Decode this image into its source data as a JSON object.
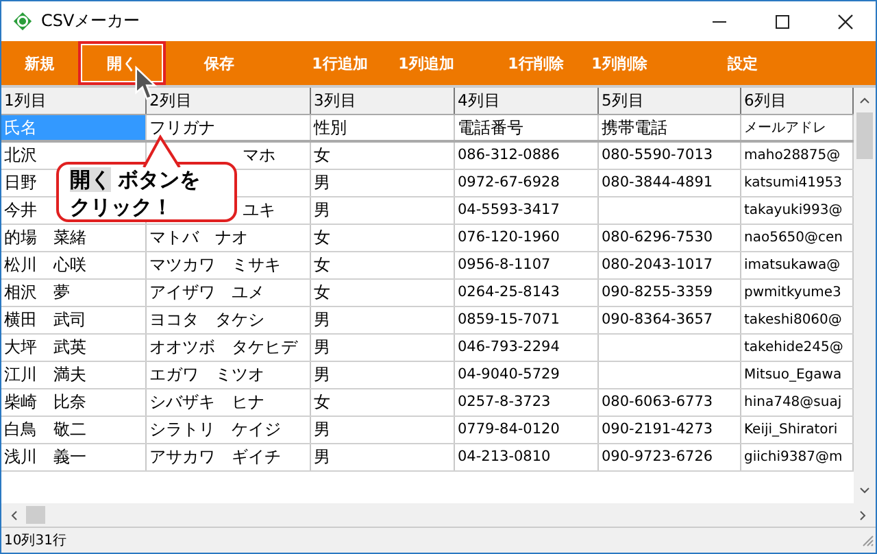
{
  "window": {
    "title": "CSVメーカー"
  },
  "toolbar": [
    {
      "label": "新規",
      "highlighted": false
    },
    {
      "label": "開く",
      "highlighted": true
    },
    {
      "label": "保存",
      "highlighted": false
    },
    {
      "label": "1行追加",
      "highlighted": false
    },
    {
      "label": "1列追加",
      "highlighted": false
    },
    {
      "label": "1行削除",
      "highlighted": false
    },
    {
      "label": "1列削除",
      "highlighted": false
    },
    {
      "label": "設定",
      "highlighted": false
    }
  ],
  "callout": {
    "highlight": "開く",
    "text": "ボタンを",
    "line2": "クリック！"
  },
  "table": {
    "columns": [
      "1列目",
      "2列目",
      "3列目",
      "4列目",
      "5列目",
      "6列目"
    ],
    "rows": [
      {
        "cells": [
          {
            "text": "氏名",
            "selected": true
          },
          {
            "text": "フリガナ",
            "selected": false
          },
          {
            "text": "性別",
            "selected": false
          },
          {
            "text": "電話番号",
            "selected": false
          },
          {
            "text": "携帯電話",
            "selected": false
          },
          {
            "text": "メールアドレ",
            "selected": false
          }
        ]
      },
      {
        "cells": [
          {
            "text": "北沢",
            "selected": false
          },
          {
            "text": "マホ",
            "selected": false
          },
          {
            "text": "女",
            "selected": false
          },
          {
            "text": "086-312-0886",
            "selected": false
          },
          {
            "text": "080-5590-7013",
            "selected": false
          },
          {
            "text": "maho28875@",
            "selected": false
          }
        ]
      },
      {
        "cells": [
          {
            "text": "日野",
            "selected": false
          },
          null,
          {
            "text": "男",
            "selected": false
          },
          {
            "text": "0972-67-6928",
            "selected": false
          },
          {
            "text": "080-3844-4891",
            "selected": false
          },
          {
            "text": "katsumi41953",
            "selected": false
          }
        ]
      },
      {
        "cells": [
          {
            "text": "今井",
            "selected": false
          },
          {
            "text": "ユキ",
            "selected": false
          },
          {
            "text": "男",
            "selected": false
          },
          {
            "text": "04-5593-3417",
            "selected": false
          },
          null,
          {
            "text": "takayuki993@",
            "selected": false
          }
        ]
      },
      {
        "cells": [
          {
            "text": "的場　菜緒",
            "selected": false
          },
          {
            "text": "マトバ　ナオ",
            "selected": false
          },
          {
            "text": "女",
            "selected": false
          },
          {
            "text": "076-120-1960",
            "selected": false
          },
          {
            "text": "080-6296-7530",
            "selected": false
          },
          {
            "text": "nao5650@cen",
            "selected": false
          }
        ]
      },
      {
        "cells": [
          {
            "text": "松川　心咲",
            "selected": false
          },
          {
            "text": "マツカワ　ミサキ",
            "selected": false
          },
          {
            "text": "女",
            "selected": false
          },
          {
            "text": "0956-8-1107",
            "selected": false
          },
          {
            "text": "080-2043-1017",
            "selected": false
          },
          {
            "text": "imatsukawa@",
            "selected": false
          }
        ]
      },
      {
        "cells": [
          {
            "text": "相沢　夢",
            "selected": false
          },
          {
            "text": "アイザワ　ユメ",
            "selected": false
          },
          {
            "text": "女",
            "selected": false
          },
          {
            "text": "0264-25-8143",
            "selected": false
          },
          {
            "text": "090-8255-3359",
            "selected": false
          },
          {
            "text": "pwmitkyume3",
            "selected": false
          }
        ]
      },
      {
        "cells": [
          {
            "text": "横田　武司",
            "selected": false
          },
          {
            "text": "ヨコタ　タケシ",
            "selected": false
          },
          {
            "text": "男",
            "selected": false
          },
          {
            "text": "0859-15-7071",
            "selected": false
          },
          {
            "text": "090-8364-3657",
            "selected": false
          },
          {
            "text": "takeshi8060@",
            "selected": false
          }
        ]
      },
      {
        "cells": [
          {
            "text": "大坪　武英",
            "selected": false
          },
          {
            "text": "オオツボ　タケヒデ",
            "selected": false
          },
          {
            "text": "男",
            "selected": false
          },
          {
            "text": "046-793-2294",
            "selected": false
          },
          null,
          {
            "text": "takehide245@",
            "selected": false
          }
        ]
      },
      {
        "cells": [
          {
            "text": "江川　満夫",
            "selected": false
          },
          {
            "text": "エガワ　ミツオ",
            "selected": false
          },
          {
            "text": "男",
            "selected": false
          },
          {
            "text": "04-9040-5729",
            "selected": false
          },
          null,
          {
            "text": "Mitsuo_Egawa",
            "selected": false
          }
        ]
      },
      {
        "cells": [
          {
            "text": "柴崎　比奈",
            "selected": false
          },
          {
            "text": "シバザキ　ヒナ",
            "selected": false
          },
          {
            "text": "女",
            "selected": false
          },
          {
            "text": "0257-8-3723",
            "selected": false
          },
          {
            "text": "080-6063-6773",
            "selected": false
          },
          {
            "text": "hina748@suaj",
            "selected": false
          }
        ]
      },
      {
        "cells": [
          {
            "text": "白鳥　敬二",
            "selected": false
          },
          {
            "text": "シラトリ　ケイジ",
            "selected": false
          },
          {
            "text": "男",
            "selected": false
          },
          {
            "text": "0779-84-0120",
            "selected": false
          },
          {
            "text": "090-2191-4273",
            "selected": false
          },
          {
            "text": "Keiji_Shiratori",
            "selected": false
          }
        ]
      },
      {
        "cells": [
          {
            "text": "浅川　義一",
            "selected": false
          },
          {
            "text": "アサカワ　ギイチ",
            "selected": false
          },
          {
            "text": "男",
            "selected": false
          },
          {
            "text": "04-213-0810",
            "selected": false
          },
          {
            "text": "090-9723-6726",
            "selected": false
          },
          {
            "text": "giichi9387@m",
            "selected": false
          }
        ]
      }
    ]
  },
  "status_bar": "10列31行"
}
